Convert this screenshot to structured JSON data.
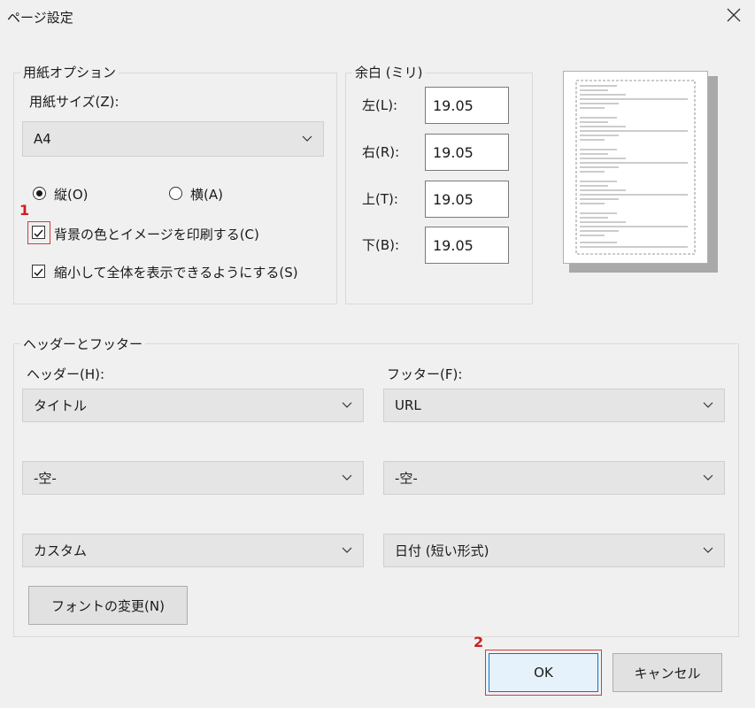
{
  "window": {
    "title": "ページ設定"
  },
  "paper_options": {
    "legend": "用紙オプション",
    "size_label": "用紙サイズ(Z):",
    "size_value": "A4",
    "orientation": {
      "portrait_label": "縦(O)",
      "landscape_label": "横(A)",
      "selected": "portrait"
    },
    "print_background_label": "背景の色とイメージを印刷する(C)",
    "print_background_checked": true,
    "shrink_to_fit_label": "縮小して全体を表示できるようにする(S)",
    "shrink_to_fit_checked": true
  },
  "margins": {
    "legend": "余白 (ミリ)",
    "left_label": "左(L):",
    "left_value": "19.05",
    "right_label": "右(R):",
    "right_value": "19.05",
    "top_label": "上(T):",
    "top_value": "19.05",
    "bottom_label": "下(B):",
    "bottom_value": "19.05"
  },
  "header_footer": {
    "legend": "ヘッダーとフッター",
    "header_label": "ヘッダー(H):",
    "footer_label": "フッター(F):",
    "header_values": [
      "タイトル",
      "-空-",
      "カスタム"
    ],
    "footer_values": [
      "URL",
      "-空-",
      "日付 (短い形式)"
    ],
    "font_button": "フォントの変更(N)"
  },
  "buttons": {
    "ok": "OK",
    "cancel": "キャンセル"
  },
  "annotations": {
    "step1": "1",
    "step2": "2",
    "color": "#cc1f1f"
  },
  "icons": {
    "close": "close-icon",
    "chevron": "chevron-down-icon",
    "check": "checkmark-icon"
  }
}
